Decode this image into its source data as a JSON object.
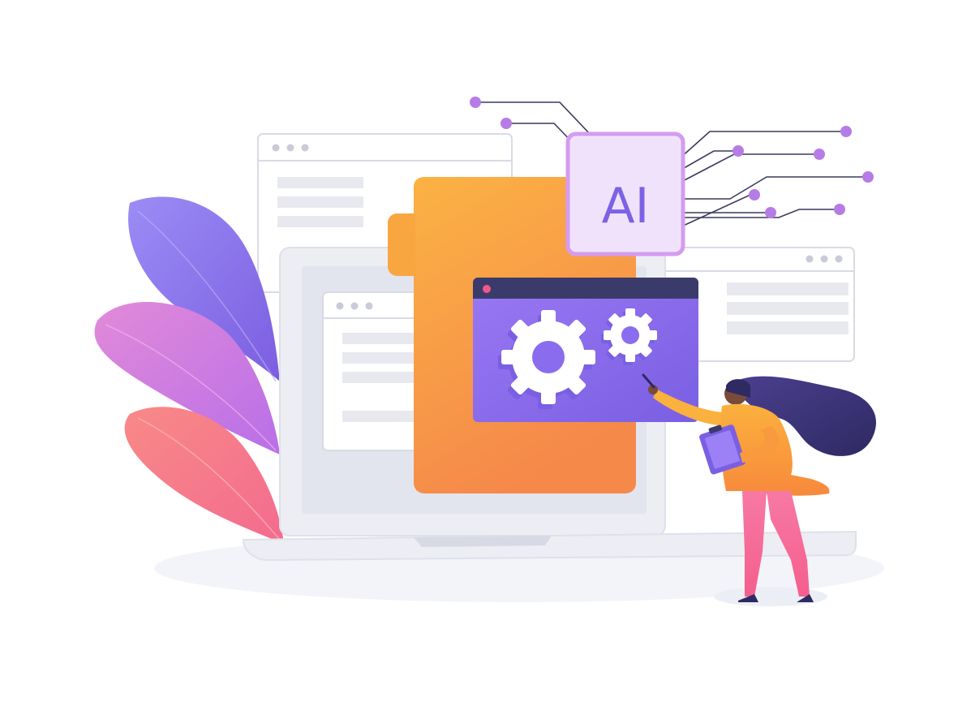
{
  "badge": {
    "label": "AI"
  },
  "colors": {
    "purple_accent": "#9b6df0",
    "purple_dark": "#6d4fd8",
    "orange_folder": "#f7a23d",
    "pink_leaf": "#f27a8d",
    "badge_fill": "#f1e2fb",
    "badge_border": "#d49cf0",
    "circuit_dot": "#b67ce6",
    "navy_bar": "#3b3b6b"
  },
  "icons": {
    "gear_large": "gear-icon",
    "gear_small": "gear-icon",
    "folder": "folder-icon",
    "laptop": "laptop-icon",
    "clipboard": "clipboard-icon"
  }
}
